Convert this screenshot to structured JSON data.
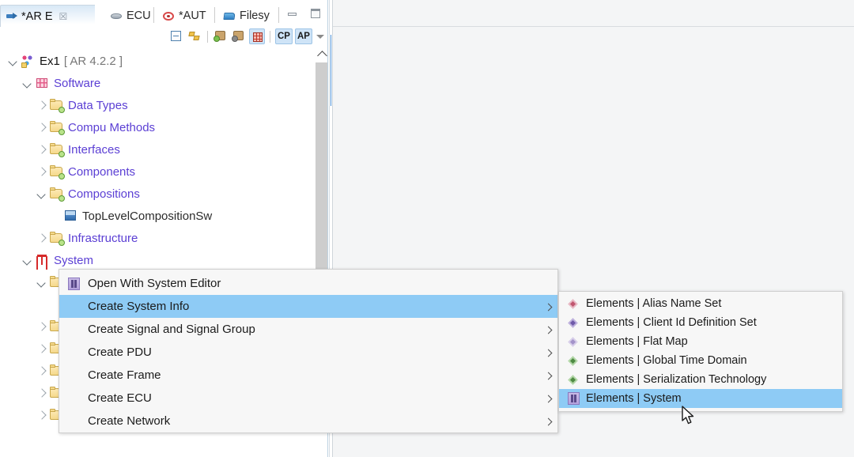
{
  "window": {
    "minimize_icon": "minimize-icon",
    "maximize_icon": "maximize-icon"
  },
  "tabs": [
    {
      "label": "*AR E",
      "icon": "arrow-right-icon",
      "active": true,
      "close_glyph": "☒"
    },
    {
      "label": "ECU",
      "icon": "disc-icon",
      "active": false
    },
    {
      "label": "*AUT",
      "icon": "red-eye-icon",
      "active": false
    },
    {
      "label": "Filesy",
      "icon": "blue-folder-icon",
      "active": false
    }
  ],
  "view_toolbar": {
    "buttons": [
      {
        "name": "collapse-all-button",
        "icon": "collapse-all-icon",
        "selected": false
      },
      {
        "name": "link-with-editor-button",
        "icon": "link-editor-icon",
        "selected": false
      },
      {
        "name": "filter-packages-button",
        "icon": "puzzle-green-icon",
        "selected": false
      },
      {
        "name": "filter-elements-button",
        "icon": "puzzle-gray-icon",
        "selected": false
      },
      {
        "name": "show-grid-button",
        "icon": "red-grid-icon",
        "selected": true
      }
    ],
    "toggle_cp": "CP",
    "toggle_ap": "AP",
    "menu_icon": "view-menu-icon"
  },
  "tree": {
    "nodes": [
      {
        "label": "Ex1",
        "suffix": "[ AR 4.2.2 ]",
        "icon": "project-icon",
        "indent": 0,
        "twisty": "open",
        "style": "root"
      },
      {
        "label": "Software",
        "suffix": "",
        "icon": "software-icon",
        "indent": 1,
        "twisty": "open",
        "style": "package"
      },
      {
        "label": "Data Types",
        "suffix": "",
        "icon": "ar-package-icon",
        "indent": 2,
        "twisty": "closed",
        "style": "package"
      },
      {
        "label": "Compu Methods",
        "suffix": "",
        "icon": "ar-package-icon",
        "indent": 2,
        "twisty": "closed",
        "style": "package"
      },
      {
        "label": "Interfaces",
        "suffix": "",
        "icon": "ar-package-icon",
        "indent": 2,
        "twisty": "closed",
        "style": "package"
      },
      {
        "label": "Components",
        "suffix": "",
        "icon": "ar-package-icon",
        "indent": 2,
        "twisty": "closed",
        "style": "package"
      },
      {
        "label": "Compositions",
        "suffix": "",
        "icon": "ar-package-icon",
        "indent": 2,
        "twisty": "open",
        "style": "package"
      },
      {
        "label": "TopLevelCompositionSw",
        "suffix": "",
        "icon": "composition-icon",
        "indent": 3,
        "twisty": "none",
        "style": "element"
      },
      {
        "label": "Infrastructure",
        "suffix": "",
        "icon": "ar-package-icon",
        "indent": 2,
        "twisty": "closed",
        "style": "package"
      },
      {
        "label": "System",
        "suffix": "",
        "icon": "system-icon",
        "indent": 1,
        "twisty": "open",
        "style": "package",
        "selected": true
      }
    ],
    "hidden_nodes": [
      {
        "icon": "ar-package-icon",
        "indent": 2,
        "twisty": "open"
      },
      {
        "icon": "ar-package-icon",
        "indent": 2,
        "twisty": "closed"
      },
      {
        "icon": "ar-package-icon",
        "indent": 2,
        "twisty": "closed"
      },
      {
        "icon": "ar-package-icon",
        "indent": 2,
        "twisty": "closed"
      },
      {
        "icon": "ar-package-icon",
        "indent": 2,
        "twisty": "closed"
      },
      {
        "icon": "ar-package-icon",
        "indent": 2,
        "twisty": "closed"
      }
    ],
    "scroll_up_icon": "scroll-up-arrow-icon"
  },
  "context_menu": {
    "items": [
      {
        "label": "Open With System Editor",
        "icon": "system-editor-icon",
        "submenu": false,
        "highlighted": false
      },
      {
        "label": "Create System Info",
        "icon": "",
        "submenu": true,
        "highlighted": true
      },
      {
        "label": "Create Signal and Signal Group",
        "icon": "",
        "submenu": true,
        "highlighted": false
      },
      {
        "label": "Create PDU",
        "icon": "",
        "submenu": true,
        "highlighted": false
      },
      {
        "label": "Create Frame",
        "icon": "",
        "submenu": true,
        "highlighted": false
      },
      {
        "label": "Create ECU",
        "icon": "",
        "submenu": true,
        "highlighted": false
      },
      {
        "label": "Create Network",
        "icon": "",
        "submenu": true,
        "highlighted": false
      }
    ]
  },
  "sub_menu": {
    "items": [
      {
        "label": "Elements | Alias Name Set",
        "icon": "diamond-icon",
        "color": "#d4798d",
        "highlighted": false
      },
      {
        "label": "Elements | Client Id Definition Set",
        "icon": "diamond-icon",
        "color": "#8a74c4",
        "highlighted": false
      },
      {
        "label": "Elements | Flat Map",
        "icon": "diamond-icon",
        "color": "#b9a8d6",
        "highlighted": false
      },
      {
        "label": "Elements | Global Time Domain",
        "icon": "diamond-icon",
        "color": "#5f9e53",
        "highlighted": false
      },
      {
        "label": "Elements | Serialization Technology",
        "icon": "diamond-icon",
        "color": "#5f9e53",
        "highlighted": false
      },
      {
        "label": "Elements | System",
        "icon": "system-editor-icon",
        "color": "#8a77bd",
        "highlighted": true
      }
    ]
  },
  "colors": {
    "selection": "#8ecbf5",
    "tree_selection": "#d6ebfb",
    "package_text": "#5b3fd4",
    "menu_bg": "#f7f7f7",
    "editor_bg": "#f4f5f6"
  },
  "cursor": {
    "name": "mouse-pointer"
  }
}
